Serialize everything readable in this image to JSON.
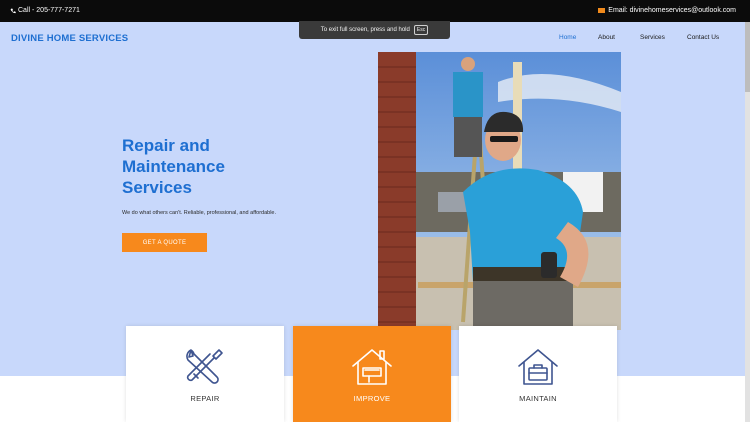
{
  "topbar": {
    "phone": "Call - 205-777-7271",
    "phone_icon": "phone-icon",
    "email": "Email: divinehomeservices@outlook.com",
    "email_icon": "mail-icon"
  },
  "header": {
    "logo": "DIVINE HOME SERVICES",
    "nav": [
      "Home",
      "About",
      "Services",
      "Contact Us"
    ],
    "active_nav": "Home"
  },
  "fullscreen_notice": {
    "text": "To exit full screen, press and hold",
    "key": "Esc"
  },
  "hero": {
    "title_lines": [
      "Repair and",
      "Maintenance",
      "Services"
    ],
    "subtitle": "We do what others can't. Reliable, professional, and affordable.",
    "cta": "GET A QUOTE"
  },
  "cards": [
    {
      "label": "REPAIR",
      "icon": "wrench-screwdriver-icon"
    },
    {
      "label": "IMPROVE",
      "icon": "house-paint-icon"
    },
    {
      "label": "MAINTAIN",
      "icon": "house-toolbox-icon"
    }
  ],
  "colors": {
    "brand_blue": "#1e6fd1",
    "accent_orange": "#f7891c",
    "hero_bg": "#c8d8fb"
  }
}
